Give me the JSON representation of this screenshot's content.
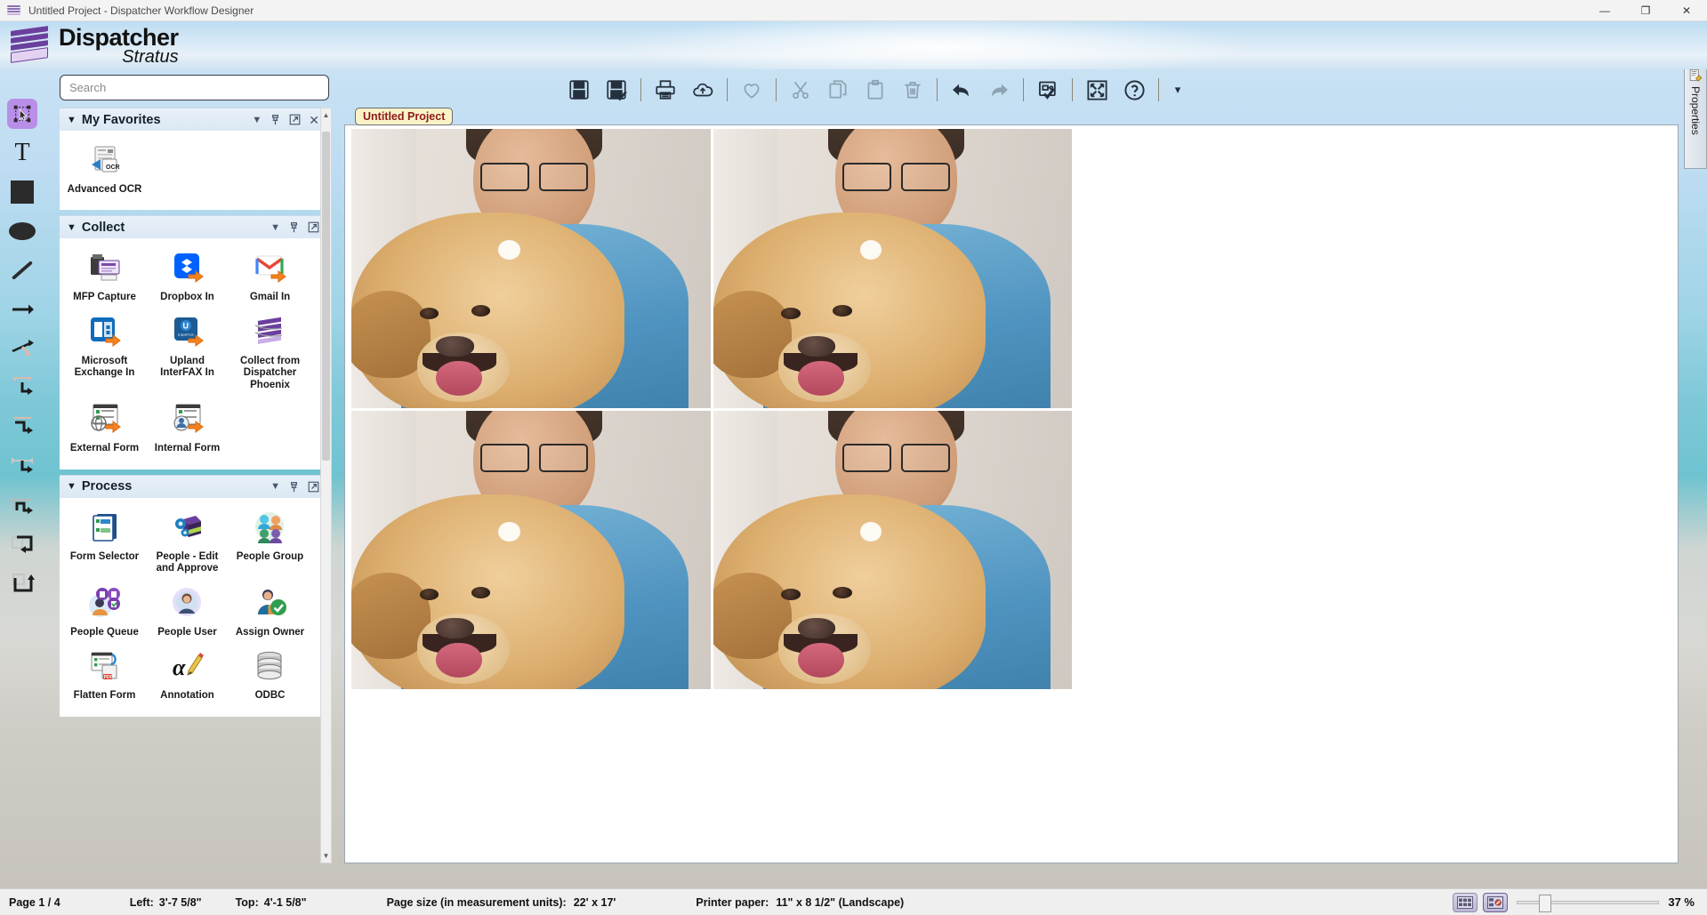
{
  "window": {
    "title": "Untitled Project - Dispatcher Workflow Designer",
    "app_icon": "dispatcher-stack-icon",
    "minimize": "—",
    "maximize": "❐",
    "close": "✕"
  },
  "brand": {
    "line1": "Dispatcher",
    "line2": "Stratus"
  },
  "search": {
    "placeholder": "Search",
    "value": ""
  },
  "toolbar": {
    "buttons": [
      {
        "name": "save-icon",
        "glyph": "save",
        "enabled": true
      },
      {
        "name": "save-as-icon",
        "glyph": "save-check",
        "enabled": true
      },
      {
        "name": "print-icon",
        "glyph": "print",
        "enabled": true
      },
      {
        "name": "publish-cloud-icon",
        "glyph": "cloud",
        "enabled": true
      },
      {
        "name": "favorite-heart-icon",
        "glyph": "heart",
        "enabled": false
      },
      {
        "name": "cut-icon",
        "glyph": "scissors",
        "enabled": false
      },
      {
        "name": "copy-icon",
        "glyph": "copy",
        "enabled": false
      },
      {
        "name": "paste-icon",
        "glyph": "paste",
        "enabled": false
      },
      {
        "name": "delete-icon",
        "glyph": "trash",
        "enabled": false
      },
      {
        "name": "undo-icon",
        "glyph": "undo",
        "enabled": true
      },
      {
        "name": "redo-icon",
        "glyph": "redo",
        "enabled": false
      },
      {
        "name": "validate-icon",
        "glyph": "validate",
        "enabled": true
      },
      {
        "name": "fit-to-screen-icon",
        "glyph": "expand",
        "enabled": true
      },
      {
        "name": "help-icon",
        "glyph": "question",
        "enabled": true
      }
    ],
    "overflow_caret": "▾"
  },
  "left_rail": {
    "tools": [
      {
        "name": "select-tool",
        "glyph": "select",
        "selected": true,
        "enabled": true
      },
      {
        "name": "text-tool",
        "glyph": "text",
        "selected": false,
        "enabled": true
      },
      {
        "name": "rectangle-tool",
        "glyph": "rectangle",
        "selected": false,
        "enabled": true
      },
      {
        "name": "ellipse-tool",
        "glyph": "ellipse",
        "selected": false,
        "enabled": true
      },
      {
        "name": "line-tool",
        "glyph": "line",
        "selected": false,
        "enabled": true
      },
      {
        "name": "straight-connector",
        "glyph": "arrow",
        "selected": false,
        "enabled": true
      },
      {
        "name": "branch-connector",
        "glyph": "branch",
        "selected": false,
        "enabled": true
      },
      {
        "name": "elbow-connector-1",
        "glyph": "elbow1",
        "selected": false,
        "enabled": true
      },
      {
        "name": "elbow-connector-2",
        "glyph": "elbow2",
        "selected": false,
        "enabled": true
      },
      {
        "name": "elbow-connector-3",
        "glyph": "elbow3",
        "selected": false,
        "enabled": true
      },
      {
        "name": "elbow-connector-4",
        "glyph": "elbow4",
        "selected": false,
        "enabled": true
      },
      {
        "name": "loop-connector-1",
        "glyph": "loop1",
        "selected": false,
        "enabled": true
      },
      {
        "name": "loop-connector-2",
        "glyph": "loop2",
        "selected": false,
        "enabled": true
      }
    ]
  },
  "palette": {
    "header_controls": {
      "collapse": "▾",
      "pin": "pin-icon",
      "popout": "popout-icon",
      "close": "✕"
    },
    "groups": [
      {
        "title": "My Favorites",
        "expanded": true,
        "has_close": true,
        "items": [
          {
            "label": "Advanced OCR",
            "icon": "advanced-ocr-icon"
          }
        ]
      },
      {
        "title": "Collect",
        "expanded": true,
        "has_close": false,
        "items": [
          {
            "label": "MFP Capture",
            "icon": "mfp-capture-icon"
          },
          {
            "label": "Dropbox In",
            "icon": "dropbox-in-icon"
          },
          {
            "label": "Gmail In",
            "icon": "gmail-in-icon"
          },
          {
            "label": "Microsoft Exchange In",
            "icon": "microsoft-exchange-in-icon"
          },
          {
            "label": "Upland InterFAX In",
            "icon": "upland-interfax-in-icon"
          },
          {
            "label": "Collect from Dispatcher Phoenix",
            "icon": "collect-from-dispatcher-phoenix-icon"
          },
          {
            "label": "External Form",
            "icon": "external-form-icon"
          },
          {
            "label": "Internal Form",
            "icon": "internal-form-icon"
          }
        ]
      },
      {
        "title": "Process",
        "expanded": true,
        "has_close": false,
        "items": [
          {
            "label": "Form Selector",
            "icon": "form-selector-icon"
          },
          {
            "label": "People - Edit and Approve",
            "icon": "people-edit-and-approve-icon"
          },
          {
            "label": "People Group",
            "icon": "people-group-icon"
          },
          {
            "label": "People Queue",
            "icon": "people-queue-icon"
          },
          {
            "label": "People User",
            "icon": "people-user-icon"
          },
          {
            "label": "Assign Owner",
            "icon": "assign-owner-icon"
          },
          {
            "label": "Flatten Form",
            "icon": "flatten-form-icon"
          },
          {
            "label": "Annotation",
            "icon": "annotation-icon"
          },
          {
            "label": "ODBC",
            "icon": "odbc-icon"
          }
        ]
      }
    ]
  },
  "canvas": {
    "project_tab": "Untitled Project",
    "pages": [
      {
        "name": "page-thumb-1"
      },
      {
        "name": "page-thumb-2"
      },
      {
        "name": "page-thumb-3"
      },
      {
        "name": "page-thumb-4"
      }
    ]
  },
  "properties_panel": {
    "label": "Properties",
    "icon": "properties-icon"
  },
  "status_bar": {
    "page": "Page 1 / 4",
    "left_label": "Left:",
    "left_value": "3'-7 5/8\"",
    "top_label": "Top:",
    "top_value": "4'-1 5/8\"",
    "page_size_label": "Page size (in measurement units):",
    "page_size_value": "22' x 17'",
    "printer_label": "Printer paper:",
    "printer_value": "11\" x 8 1/2\"  (Landscape)",
    "view_grid_button": "grid-view-icon",
    "view_page_button": "page-view-icon",
    "zoom": "37 %"
  },
  "colors": {
    "accent_purple": "#6b3f9e",
    "tab_yellow": "#fbf3c8",
    "tab_text": "#8b1a1a",
    "selection_lilac": "#b98ee8"
  }
}
